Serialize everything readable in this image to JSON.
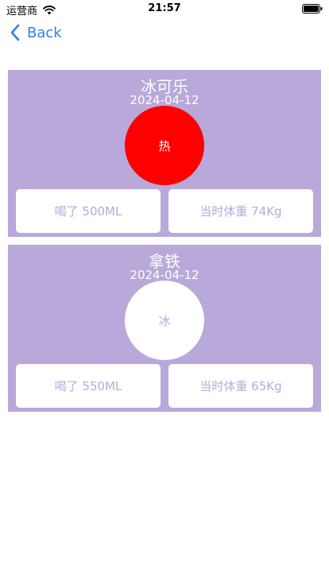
{
  "status_bar": {
    "carrier": "运营商",
    "time": "21:57"
  },
  "nav": {
    "back_label": "Back",
    "accent_color": "#2f80ed"
  },
  "cards": [
    {
      "title": "冰可乐",
      "date": "2024-04-12",
      "temperature": "热",
      "amount": "喝了 500ML",
      "weight": "当时体重 74Kg"
    },
    {
      "title": "拿铁",
      "date": "2024-04-12",
      "temperature": "冰",
      "amount": "喝了 550ML",
      "weight": "当时体重 65Kg"
    }
  ],
  "colors": {
    "card_background": "#b9a8da",
    "hot": "#ff0000",
    "cold": "#ffffff"
  }
}
